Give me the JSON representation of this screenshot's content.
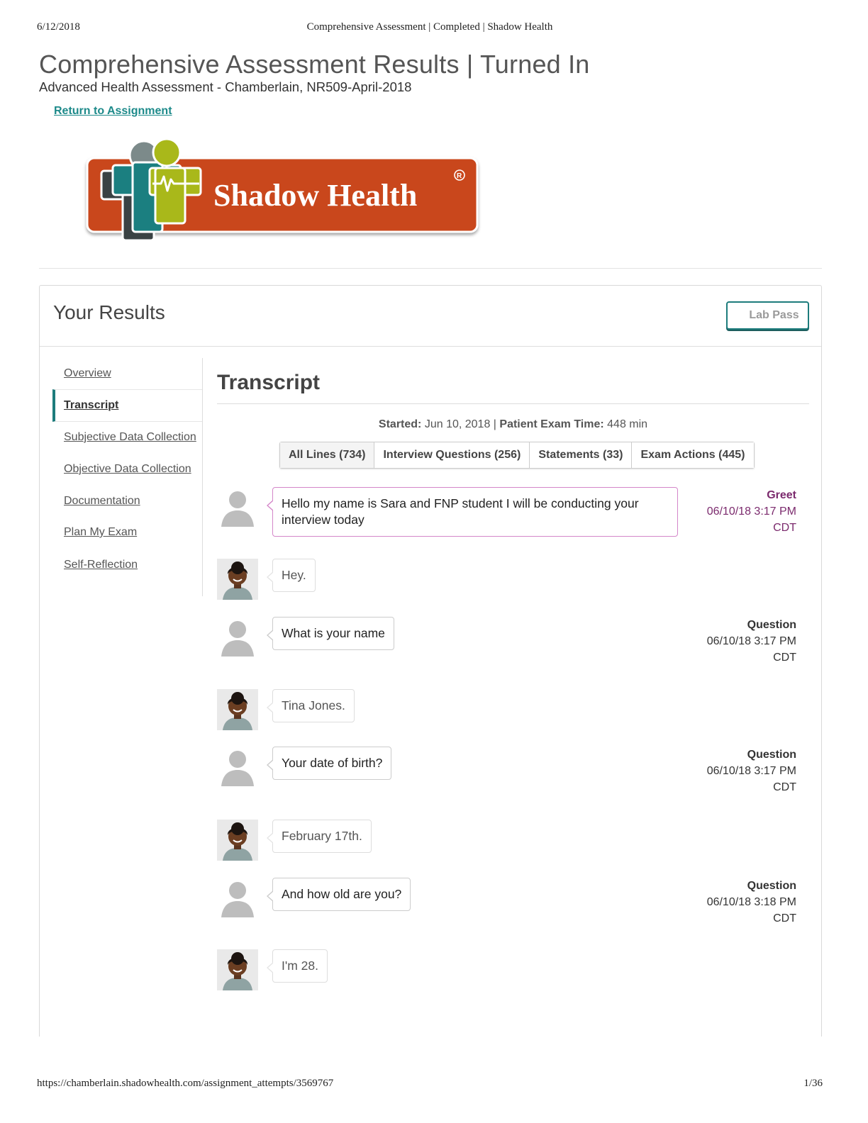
{
  "print": {
    "date": "6/12/2018",
    "doc_title": "Comprehensive Assessment | Completed | Shadow Health",
    "url": "https://chamberlain.shadowhealth.com/assignment_attempts/3569767",
    "page": "1/36"
  },
  "page": {
    "title": "Comprehensive Assessment Results | Turned In",
    "subtitle": "Advanced Health Assessment - Chamberlain, NR509-April-2018",
    "return_link": "Return to Assignment"
  },
  "logo": {
    "text": "Shadow Health"
  },
  "results": {
    "title": "Your Results",
    "lab_pass": "Lab Pass"
  },
  "nav": [
    {
      "label": "Overview"
    },
    {
      "label": "Transcript"
    },
    {
      "label": "Subjective Data Collection"
    },
    {
      "label": "Objective Data Collection"
    },
    {
      "label": "Documentation"
    },
    {
      "label": "Plan My Exam"
    },
    {
      "label": "Self-Reflection"
    }
  ],
  "transcript": {
    "title": "Transcript",
    "started_label": "Started:",
    "started_value": " Jun 10, 2018 | ",
    "exam_time_label": "Patient Exam Time:",
    "exam_time_value": " 448 min",
    "tabs": [
      {
        "label": "All Lines (734)"
      },
      {
        "label": "Interview Questions (256)"
      },
      {
        "label": "Statements (33)"
      },
      {
        "label": "Exam Actions (445)"
      }
    ],
    "messages": [
      {
        "speaker": "student",
        "text": "Hello my name is Sara and FNP student I will be conducting your interview today",
        "type": "Greet",
        "date": "06/10/18 3:17 PM",
        "tz": "CDT"
      },
      {
        "speaker": "patient",
        "text": "Hey."
      },
      {
        "speaker": "student",
        "text": "What is your name",
        "type": "Question",
        "date": "06/10/18 3:17 PM",
        "tz": "CDT"
      },
      {
        "speaker": "patient",
        "text": "Tina Jones."
      },
      {
        "speaker": "student",
        "text": "Your date of birth?",
        "type": "Question",
        "date": "06/10/18 3:17 PM",
        "tz": "CDT"
      },
      {
        "speaker": "patient",
        "text": "February 17th."
      },
      {
        "speaker": "student",
        "text": "And how old are you?",
        "type": "Question",
        "date": "06/10/18 3:18 PM",
        "tz": "CDT"
      },
      {
        "speaker": "patient",
        "text": "I'm 28."
      }
    ]
  },
  "colors": {
    "teal": "#1d7c7c",
    "greet_purple": "#7b2a6d",
    "greet_border": "#d486c9",
    "logo_orange": "#c9461f",
    "logo_green": "#a9b81a"
  }
}
